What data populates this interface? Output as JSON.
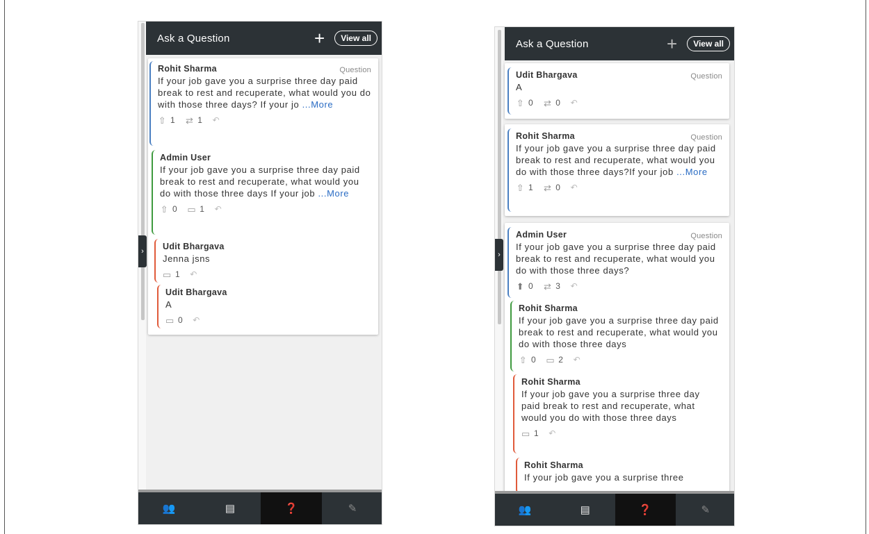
{
  "header_title": "Ask a Question",
  "header_plus": "+",
  "view_all": "View all",
  "toggle_glyph": "›",
  "icons": {
    "upvote": "⇧",
    "upvote_filled": "⬆",
    "repost": "⇄",
    "comment": "▭",
    "reply": "↶"
  },
  "footer_tabs": [
    {
      "icon": "people-icon",
      "glyph": "👥"
    },
    {
      "icon": "chat-icon",
      "glyph": "▤"
    },
    {
      "icon": "qa-icon",
      "glyph": "❓"
    },
    {
      "icon": "edit-icon",
      "glyph": "✎"
    }
  ],
  "left": {
    "card": [
      {
        "name": "Rohit Sharma",
        "type": "Question",
        "text": "If your job gave you a surprise three day paid break to rest and recuperate, what would you do with those three days? If your jo",
        "more": "...More",
        "up": "1",
        "second": "1"
      },
      {
        "name": "Admin User",
        "text": "If your job gave you a surprise three day paid break to rest and recuperate, what would you do with those three days If your job",
        "more": "...More",
        "up": "0",
        "second": "1"
      },
      {
        "name": "Udit Bhargava",
        "text": "Jenna jsns",
        "second": "1"
      },
      {
        "name": "Udit Bhargava",
        "text": "A",
        "second": "0"
      }
    ]
  },
  "right": {
    "card1": {
      "name": "Udit Bhargava",
      "type": "Question",
      "text": "A",
      "up": "0",
      "second": "0"
    },
    "card2": {
      "name": "Rohit Sharma",
      "type": "Question",
      "text": "If your job gave you a surprise three day paid break to rest and recuperate, what would you do with those three days?If your job",
      "more": "...More",
      "up": "1",
      "second": "0"
    },
    "card3": [
      {
        "name": "Admin User",
        "type": "Question",
        "text": "If your job gave you a surprise three day paid break to rest and recuperate, what would you do with those three days?",
        "up": "0",
        "second": "3"
      },
      {
        "name": "Rohit Sharma",
        "text": "If your job gave you a surprise three day paid break to rest and recuperate, what would you do with those three days",
        "up": "0",
        "second": "2"
      },
      {
        "name": "Rohit Sharma",
        "text": "If your job gave you a surprise three day paid break to rest and recuperate, what would you do with those three days",
        "second": "1"
      },
      {
        "name": "Rohit Sharma",
        "text": "If your job gave you a surprise three"
      }
    ]
  }
}
